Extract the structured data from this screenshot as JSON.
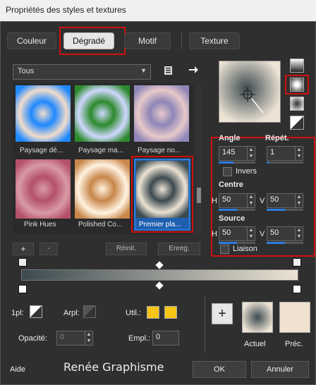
{
  "window": {
    "title": "Propriétés des styles et textures"
  },
  "tabs": [
    {
      "label": "Couleur"
    },
    {
      "label": "Dégradé"
    },
    {
      "label": "Motif"
    },
    {
      "label": "Texture"
    }
  ],
  "category": {
    "selected": "Tous"
  },
  "gradients": [
    {
      "caption": "Paysage dé...",
      "colors": [
        "#1e88ff",
        "#f2dccb"
      ]
    },
    {
      "caption": "Paysage ma...",
      "colors": [
        "#2c8a2c",
        "#cfd8ff"
      ]
    },
    {
      "caption": "Paysage no...",
      "colors": [
        "#8f86b8",
        "#e7c9c9"
      ]
    },
    {
      "caption": "Pink Hues",
      "colors": [
        "#b5506a",
        "#d89aa6"
      ]
    },
    {
      "caption": "Polished Co...",
      "colors": [
        "#c8864a",
        "#fff3e1"
      ]
    },
    {
      "caption": "Premier pla...",
      "colors": [
        "#3c4a50",
        "#ece3d4"
      ]
    }
  ],
  "list_buttons": {
    "add": "+",
    "remove": "-",
    "reset": "Réinit.",
    "save": "Enreg."
  },
  "angle": {
    "label": "Angle",
    "value": "145"
  },
  "repeat": {
    "label": "Répét.",
    "value": "1"
  },
  "invert": {
    "label": "Invers"
  },
  "centre": {
    "label": "Centre",
    "h_label": "H",
    "h_value": "50",
    "v_label": "V",
    "v_value": "50"
  },
  "source": {
    "label": "Source",
    "h_label": "H",
    "h_value": "50",
    "v_label": "V",
    "v_value": "50"
  },
  "link": {
    "label": "Liaison"
  },
  "bottom": {
    "stroke_label": "1pl:",
    "fill_label": "Arpl:",
    "use_label": "Util.:",
    "opacity_label": "Opacité:",
    "opacity_value": "0",
    "position_label": "Empl.:",
    "position_value": "0",
    "swatch_color": "#f5c518"
  },
  "preview": {
    "current_label": "Actuel",
    "previous_label": "Préc.",
    "previous_color": "#efe2d1"
  },
  "footer": {
    "help": "Aide",
    "watermark": "Renée Graphisme",
    "ok": "OK",
    "cancel": "Annuler"
  }
}
